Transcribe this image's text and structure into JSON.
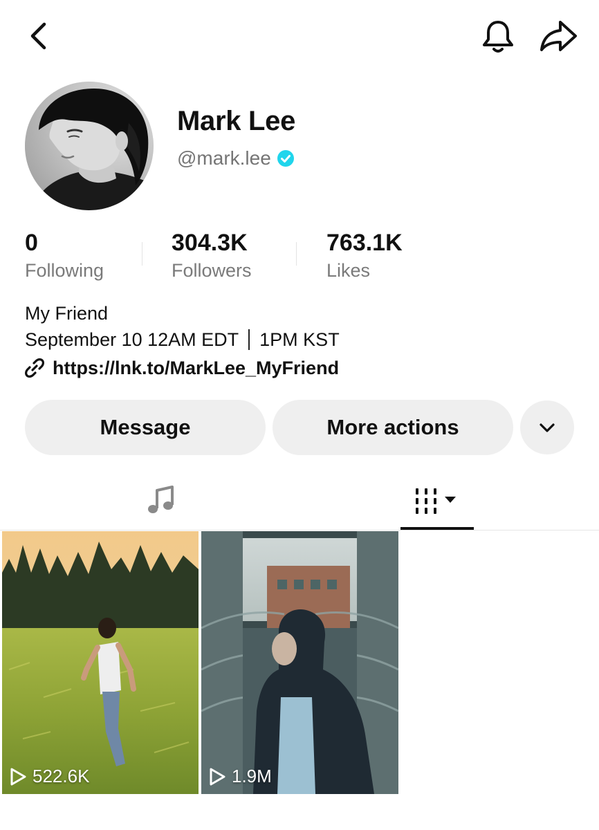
{
  "profile": {
    "name": "Mark Lee",
    "handle": "@mark.lee",
    "verified": true,
    "avatar": "profile-photo"
  },
  "stats": [
    {
      "value": "0",
      "label": "Following"
    },
    {
      "value": "304.3K",
      "label": "Followers"
    },
    {
      "value": "763.1K",
      "label": "Likes"
    }
  ],
  "bio": {
    "line1": "My Friend",
    "line2_date": "September 10 12AM EDT",
    "line2_time": "1PM KST",
    "link": "https://lnk.to/MarkLee_MyFriend"
  },
  "actions": {
    "message": "Message",
    "more_actions": "More actions"
  },
  "tabs": {
    "active": "videos-grid"
  },
  "videos": [
    {
      "views": "522.6K",
      "thumbnail": "man-running-in-grass-field"
    },
    {
      "views": "1.9M",
      "thumbnail": "man-in-hood-under-covered-walkway"
    }
  ],
  "colors": {
    "verified": "#20D5EC",
    "button_bg": "#EFEFEF",
    "secondary_text": "#7A7A7A"
  },
  "icons": [
    "back-icon",
    "bell-icon",
    "share-icon",
    "verified-icon",
    "link-icon",
    "chevron-down-icon",
    "music-note-icon",
    "grid-icon",
    "play-icon"
  ]
}
